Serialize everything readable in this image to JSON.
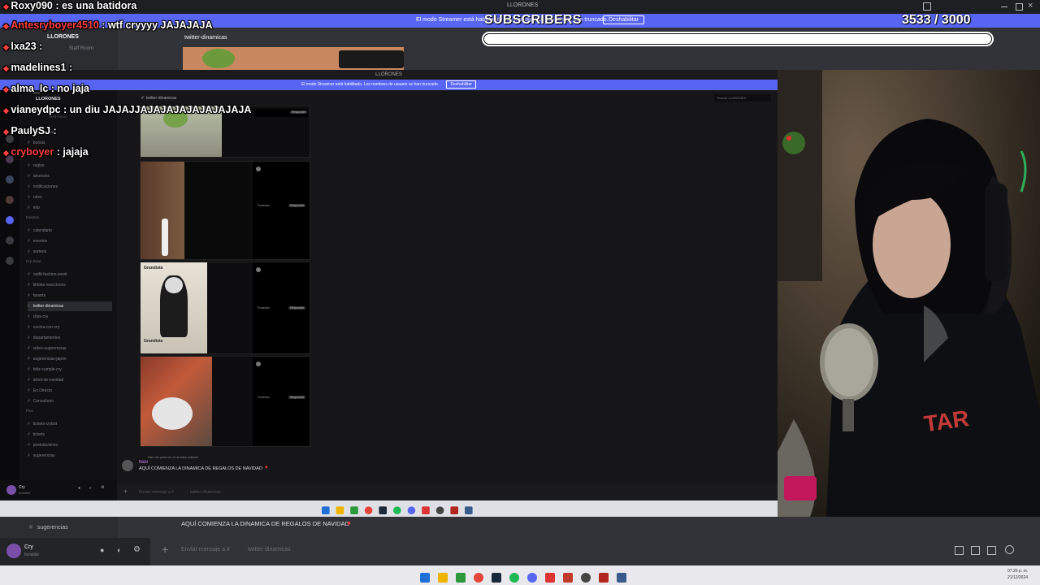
{
  "outer": {
    "server_name": "LLORONES",
    "window_title": "LLORONES",
    "banner_text": "El modo Streamer está habilitado. Los nombres de usuario se han truncado.",
    "banner_button": "Deshabilitar",
    "channel_header": "twitter-dinamicas",
    "staff_room": "Staff Room",
    "sidebar_last_item": "sugerencias",
    "user_name": "Cry",
    "user_status": "Invisible",
    "message_text": "AQUÍ COMIENZA LA DINAMICA DE REGALOS DE NAVIDAD",
    "input_placeholder": "Enviar mensaje a #",
    "input_channel": "twitter-dinamicas",
    "clock_time": "07:26 p. m.",
    "clock_date": "21/12/2024"
  },
  "inner": {
    "window_title": "LLORONES",
    "banner_text": "El modo Streamer está habilitado. Los nombres de usuario se han truncado.",
    "banner_button": "Deshabilitar",
    "server_name": "LLORONES",
    "channel_header": "twitter-dinamicas",
    "search_placeholder": "Buscar LLORONES",
    "staff_room": "Staff Room",
    "channels_top": [
      "bienvenidas",
      "boosts"
    ],
    "cat_importante": "Importante",
    "channels_importante": [
      "reglas",
      "anuncios",
      "notificaciones",
      "roles",
      "info"
    ],
    "cat_eventos": "Eventos",
    "channels_eventos": [
      "calendario",
      "eventos",
      "sorteos"
    ],
    "cat_cry": "Cry Zone",
    "channels_cry": [
      "outfit-fashion-week",
      "tiktoks-reacciones",
      "fanarts",
      "twitter-dinamicas",
      "clips-cry",
      "cocina-con-cry",
      "departamentos",
      "video-sugerencias",
      "sugerencias-japón",
      "feliz-cumple-cry",
      "árbol-de-navidad",
      "En Directo",
      "Consultorio"
    ],
    "cat_plus": "Plus",
    "channels_plus": [
      "tickets-crybot",
      "tickets",
      "postulaciones",
      "sugerencias"
    ],
    "user_name": "Cry",
    "user_status": "Invisible",
    "reply_line": "Haz clic para ver el archivo adjunto",
    "message_author": "Nicki",
    "message_text": "AQUÍ COMIENZA LA DINAMICA DE REGALOS DE NAVIDAD",
    "input_placeholder": "Enviar mensaje a #",
    "input_channel": "twitter-dinamicas",
    "tweet_label": "Posteado",
    "tweet_button": "Responder",
    "poster_text": "Grandista"
  },
  "chat": [
    {
      "user": "Roxy090",
      "text": "es una batidora"
    },
    {
      "user": "Antesryboyer4510",
      "text": "wtf cryyyy JAJAJAJA"
    },
    {
      "user": "lxa23",
      "text": ""
    },
    {
      "user": "madelines1",
      "text": ""
    },
    {
      "user": "alma_lc",
      "text": "no jaja"
    },
    {
      "user": "vianeydpc",
      "text": "un diu JAJAJJAJAJAJAJAJAJAJAJA"
    },
    {
      "user": "PaulySJ",
      "text": ""
    },
    {
      "user": "cryboyer",
      "text": "jajaja"
    }
  ],
  "subgoal": {
    "label": "SUBSCRIBERS",
    "current": 3533,
    "target": 3000,
    "count_text": "3533  / 3000",
    "progress": 1.0
  },
  "colors": {
    "accent": "#5865f2",
    "chat_username": "#ff4040",
    "goal_fill": "#ffffff"
  }
}
